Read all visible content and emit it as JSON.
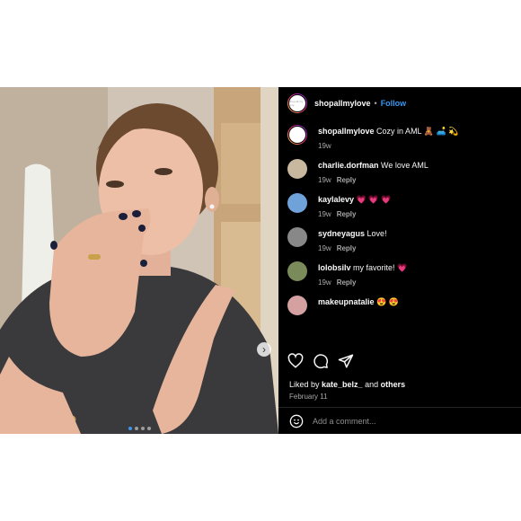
{
  "post": {
    "username": "shopallmylove",
    "separator": "•",
    "follow_label": "Follow",
    "avatar_text": "shop all my love"
  },
  "caption": {
    "username": "shopallmylove",
    "text": "Cozy in AML 🧸 🛋️ 💫",
    "age": "19w"
  },
  "comments": [
    {
      "username": "charlie.dorfman",
      "text": "We love AML",
      "age": "19w",
      "reply_label": "Reply",
      "avatar_color": "#c9b8a0"
    },
    {
      "username": "kaylalevy",
      "text": "💗 💗 💗",
      "age": "19w",
      "reply_label": "Reply",
      "avatar_color": "#6fa2d8"
    },
    {
      "username": "sydneyagus",
      "text": "Love!",
      "age": "19w",
      "reply_label": "Reply",
      "avatar_color": "#888888"
    },
    {
      "username": "lolobsilv",
      "text": "my favorite! 💗",
      "age": "19w",
      "reply_label": "Reply",
      "avatar_color": "#7a8a5a"
    },
    {
      "username": "makeupnatalie",
      "text": "😍 😍",
      "age": "",
      "reply_label": "",
      "avatar_color": "#d4a0a0"
    }
  ],
  "likes": {
    "prefix": "Liked by ",
    "user": "kate_belz_",
    "middle": " and ",
    "others": "others"
  },
  "date": "February 11",
  "add_comment": {
    "placeholder": "Add a comment..."
  },
  "media": {
    "carousel_dots": 4,
    "active_dot": 0
  },
  "icons": [
    "heart-icon",
    "comment-icon",
    "share-icon",
    "emoji-icon",
    "chevron-right-icon"
  ],
  "colors": {
    "follow_blue": "#3897f0",
    "panel_bg": "#000000",
    "muted_text": "#a8a8a8"
  }
}
